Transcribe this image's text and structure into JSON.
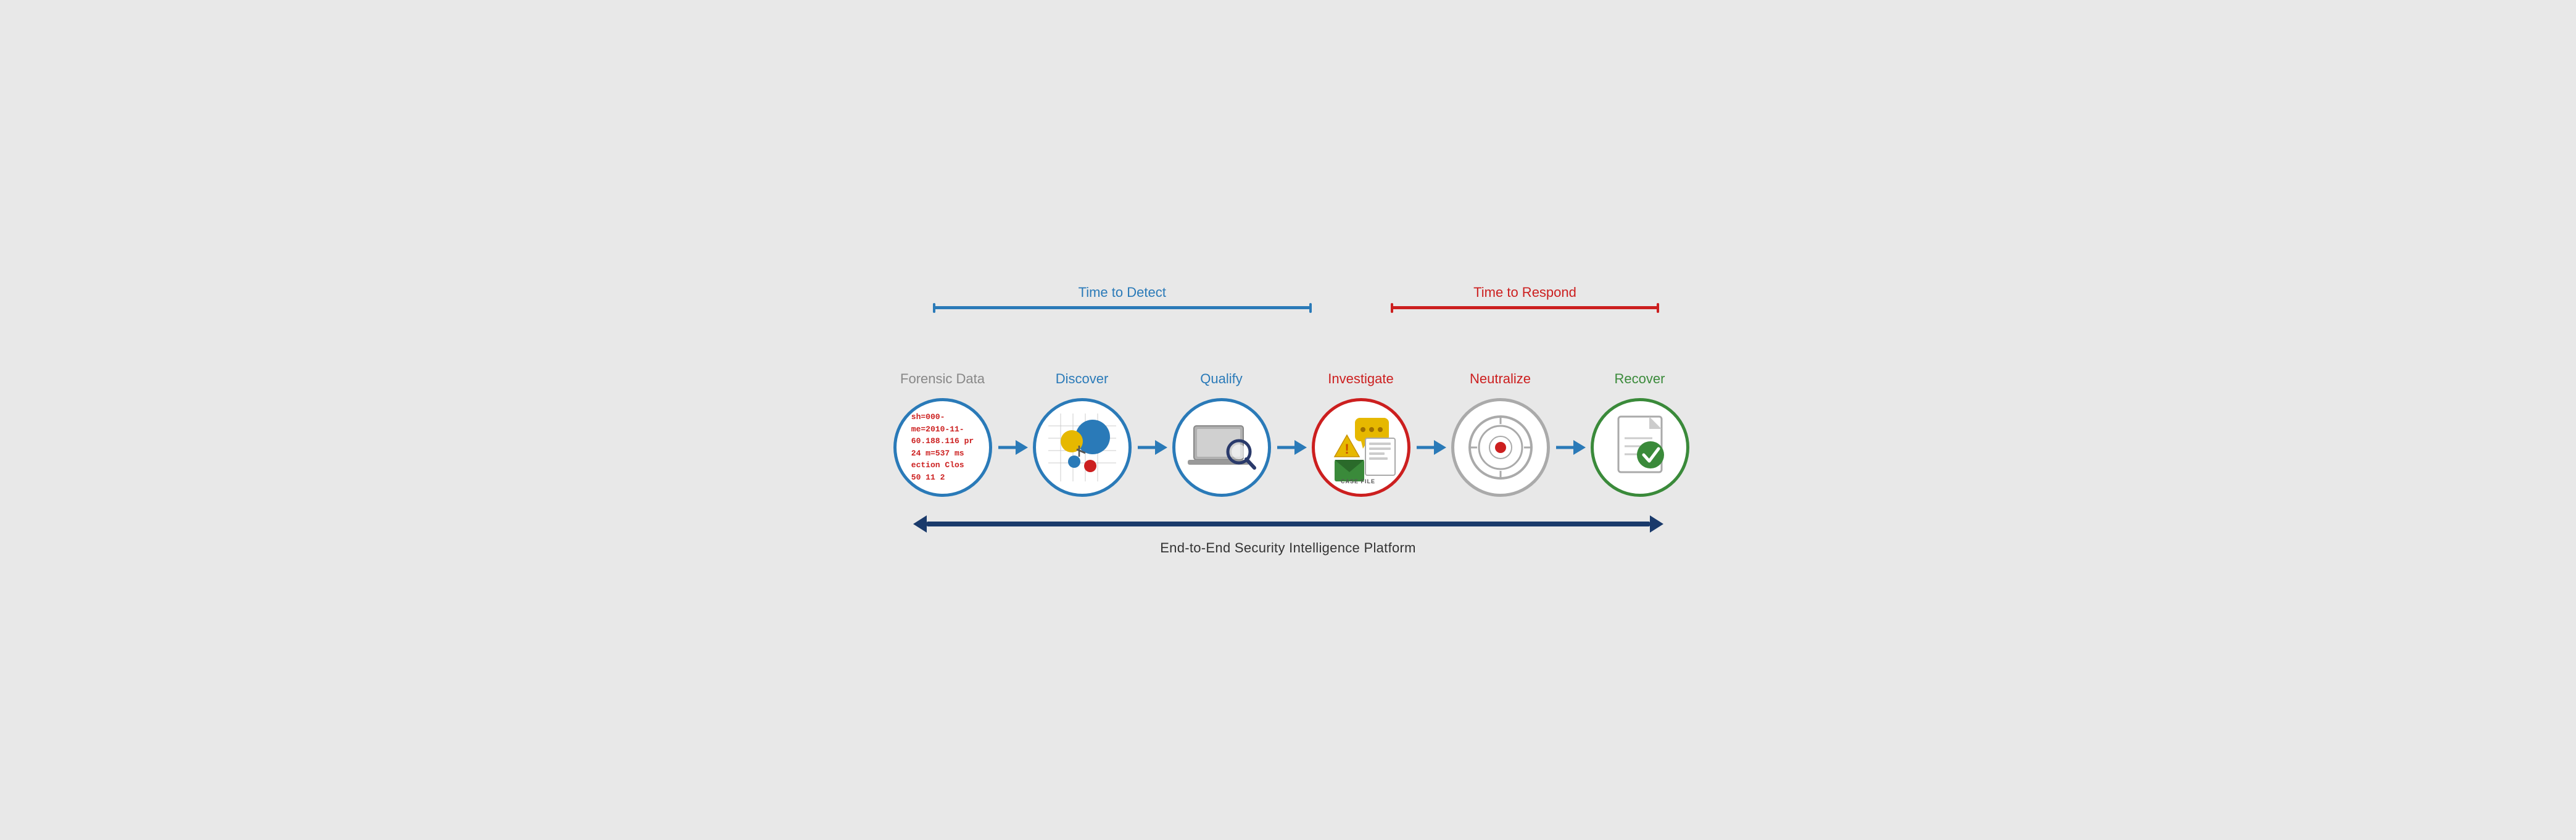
{
  "timeDetect": {
    "label": "Time to Detect",
    "color": "#2a7ab8"
  },
  "timeRespond": {
    "label": "Time to Respond",
    "color": "#cc1f1f"
  },
  "stages": [
    {
      "id": "forensic",
      "label": "Forensic Data",
      "labelColor": "gray",
      "borderColor": "blue",
      "type": "forensic",
      "lines": [
        "sh=000-",
        "me=2010-11-",
        "60.188.116 pr",
        "24 m=537 ms",
        "ection Clos",
        "50 11 2"
      ]
    },
    {
      "id": "discover",
      "label": "Discover",
      "labelColor": "blue",
      "borderColor": "blue",
      "type": "discover"
    },
    {
      "id": "qualify",
      "label": "Qualify",
      "labelColor": "blue",
      "borderColor": "blue",
      "type": "qualify"
    },
    {
      "id": "investigate",
      "label": "Investigate",
      "labelColor": "red",
      "borderColor": "red",
      "type": "investigate"
    },
    {
      "id": "neutralize",
      "label": "Neutralize",
      "labelColor": "red",
      "borderColor": "gray",
      "type": "neutralize"
    },
    {
      "id": "recover",
      "label": "Recover",
      "labelColor": "green",
      "borderColor": "green",
      "type": "recover"
    }
  ],
  "bottomLabel": "End-to-End Security Intelligence Platform",
  "caseFileLabel": "CASE FILE",
  "arrowColor": "#2a7ab8",
  "bottomArrowColor": "#1a3a6b"
}
